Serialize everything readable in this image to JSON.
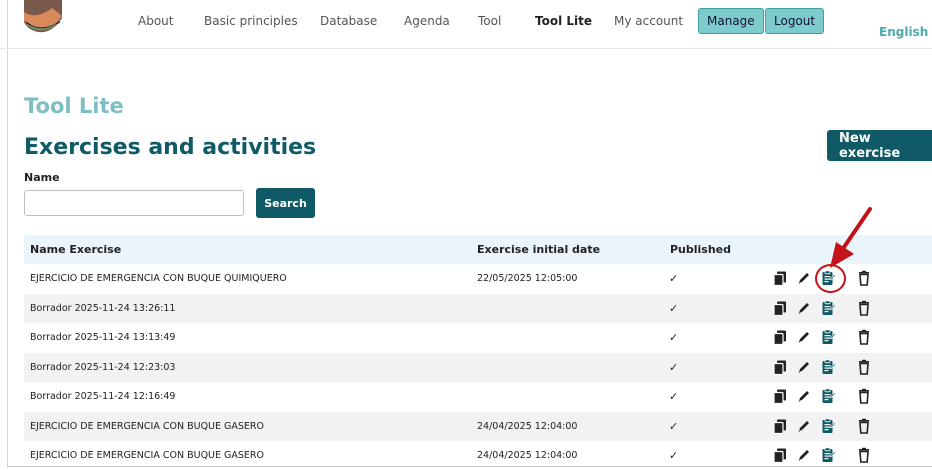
{
  "nav": {
    "items": [
      "About",
      "Basic principles",
      "Database",
      "Agenda",
      "Tool",
      "Tool Lite",
      "My account"
    ],
    "active": "Tool Lite",
    "manage_label": "Manage",
    "logout_label": "Logout",
    "language": "English"
  },
  "page": {
    "section_title": "Tool Lite",
    "title": "Exercises and activities",
    "new_exercise_label": "New exercise"
  },
  "search": {
    "label": "Name",
    "value": "",
    "button_label": "Search"
  },
  "table": {
    "columns": [
      "Name Exercise",
      "Exercise initial date",
      "Published"
    ],
    "rows": [
      {
        "name": "EJERCICIO DE EMERGENCIA CON BUQUE QUIMIQUERO",
        "date": "22/05/2025 12:05:00",
        "published": "✓"
      },
      {
        "name": "Borrador 2025-11-24 13:26:11",
        "date": "",
        "published": "✓"
      },
      {
        "name": "Borrador 2025-11-24 13:13:49",
        "date": "",
        "published": "✓"
      },
      {
        "name": "Borrador 2025-11-24 12:23:03",
        "date": "",
        "published": "✓"
      },
      {
        "name": "Borrador 2025-11-24 12:16:49",
        "date": "",
        "published": "✓"
      },
      {
        "name": "EJERCICIO DE EMERGENCIA CON BUQUE GASERO",
        "date": "24/04/2025 12:04:00",
        "published": "✓"
      },
      {
        "name": "EJERCICIO DE EMERGENCIA CON BUQUE GASERO",
        "date": "24/04/2025 12:04:00",
        "published": "✓"
      }
    ],
    "row_actions": [
      "copy-icon",
      "edit-icon",
      "clipboard-icon",
      "delete-icon"
    ]
  },
  "colors": {
    "primary": "#0f5a66",
    "accent": "#7ecbcc",
    "header_bg": "#e9f5fa",
    "annotation": "#c4121a"
  }
}
